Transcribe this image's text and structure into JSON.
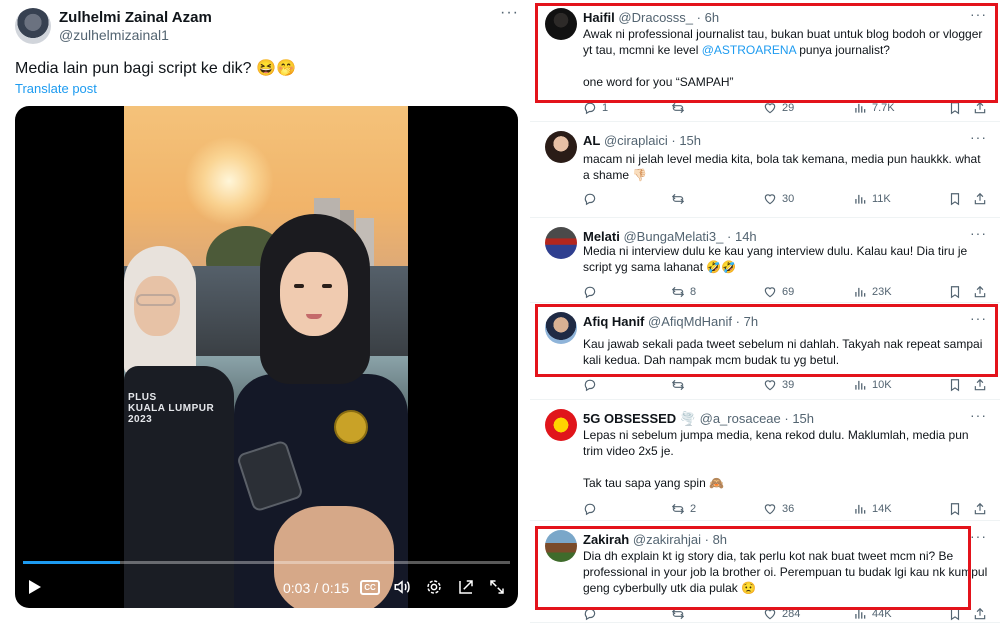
{
  "post": {
    "author_name": "Zulhelmi Zainal Azam",
    "author_handle": "@zulhelmizainal1",
    "text": "Media lain pun bagi script ke dik? 😆🤭",
    "translate_label": "Translate post",
    "video": {
      "shirt_text": "PLUS\nKUALA LUMPUR\n2023",
      "time_display": "0:03 / 0:15",
      "progress_fraction": 0.2,
      "cc_label": "CC"
    }
  },
  "replies": [
    {
      "name": "Haifil",
      "handle": "@Dracosss_",
      "time": "6h",
      "body_pre": "Awak ni professional journalist tau, bukan buat untuk blog bodoh or vlogger yt tau, mcmni ke level ",
      "mention": "@ASTROARENA",
      "body_post": " punya journalist?\n\none word for you “SAMPAH”",
      "replies": "1",
      "retweets": "",
      "likes": "29",
      "views": "7.7K",
      "highlighted": true
    },
    {
      "name": "AL",
      "handle": "@ciraplaici",
      "time": "15h",
      "body_pre": "macam ni jelah level media kita, bola tak kemana, media pun haukkk. what a shame 👎🏻",
      "mention": "",
      "body_post": "",
      "replies": "",
      "retweets": "",
      "likes": "30",
      "views": "11K",
      "highlighted": false
    },
    {
      "name": "Melati",
      "handle": "@BungaMelati3_",
      "time": "14h",
      "body_pre": "Media ni interview dulu ke kau yang interview dulu. Kalau kau! Dia tiru je script yg sama lahanat 🤣🤣",
      "mention": "",
      "body_post": "",
      "replies": "",
      "retweets": "8",
      "likes": "69",
      "views": "23K",
      "highlighted": false
    },
    {
      "name": "Afiq Hanif",
      "handle": "@AfiqMdHanif",
      "time": "7h",
      "body_pre": "Kau jawab sekali pada tweet sebelum ni dahlah. Takyah nak repeat sampai kali kedua. Dah nampak mcm budak tu yg betul.",
      "mention": "",
      "body_post": "",
      "replies": "",
      "retweets": "",
      "likes": "39",
      "views": "10K",
      "highlighted": true
    },
    {
      "name": "5G OBSESSED 🌪️",
      "handle": "@a_rosaceae",
      "time": "15h",
      "body_pre": "Lepas ni sebelum jumpa media, kena rekod dulu. Maklumlah, media pun trim video 2x5 je.\n\nTak tau sapa yang spin 🙈",
      "mention": "",
      "body_post": "",
      "replies": "",
      "retweets": "2",
      "likes": "36",
      "views": "14K",
      "highlighted": false
    },
    {
      "name": "Zakirah",
      "handle": "@zakirahjai",
      "time": "8h",
      "body_pre": "Dia dh explain kt ig story dia, tak perlu kot nak buat tweet mcm ni? Be professional in your job la brother oi. Perempuan tu budak lgi kau nk kumpul geng cyberbully utk dia pulak 😟",
      "mention": "",
      "body_post": "",
      "replies": "",
      "retweets": "",
      "likes": "284",
      "views": "44K",
      "highlighted": true
    }
  ],
  "icons": {
    "reply": "reply-icon",
    "retweet": "retweet-icon",
    "like": "heart-icon",
    "views": "views-icon",
    "bookmark": "bookmark-icon",
    "share": "share-icon"
  },
  "colors": {
    "accent": "#1d9bf0",
    "highlight_box": "#e3131b",
    "secondary_text": "#536471"
  }
}
